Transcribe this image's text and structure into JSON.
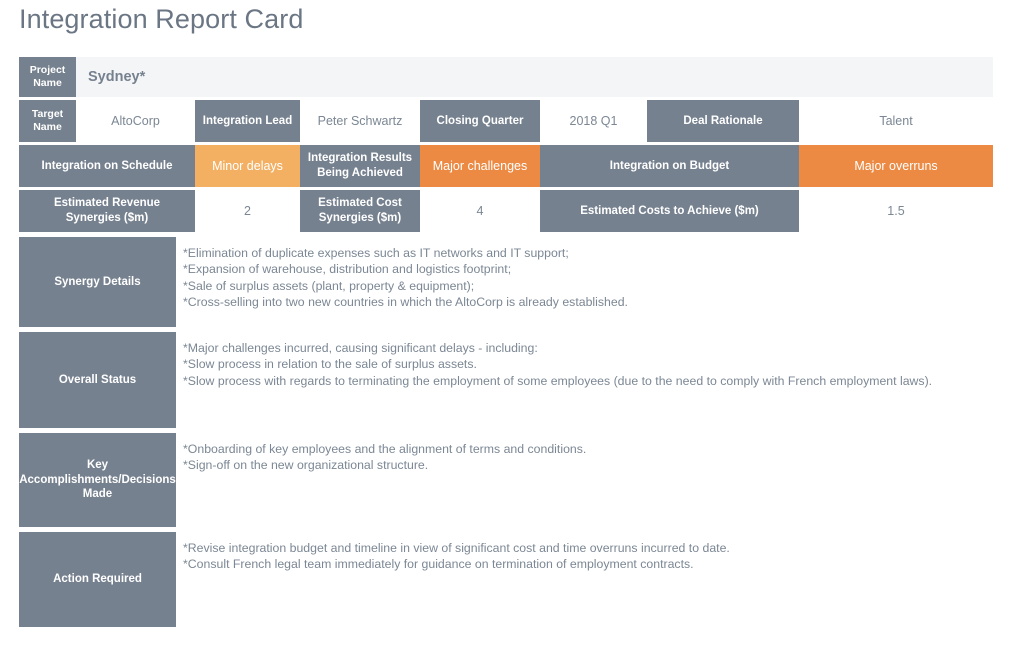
{
  "page": {
    "title": "Integration Report Card"
  },
  "colors": {
    "slate": "#76818f",
    "amber": "#f3b063",
    "orange": "#ec8a43",
    "banner_bg": "#f4f5f6",
    "value_text": "#7b8794"
  },
  "project_row": {
    "label": "Project\nName",
    "value": "Sydney*"
  },
  "target_row": {
    "cells": [
      {
        "label": "Target\nName",
        "type": "label"
      },
      {
        "label": "AltoCorp",
        "type": "value"
      },
      {
        "label": "Integration Lead",
        "type": "label"
      },
      {
        "label": "Peter Schwartz",
        "type": "value"
      },
      {
        "label": "Closing Quarter",
        "type": "label"
      },
      {
        "label": "2018 Q1",
        "type": "value"
      },
      {
        "label": "Deal Rationale",
        "type": "label"
      },
      {
        "label": "Talent",
        "type": "value"
      }
    ]
  },
  "status_row": {
    "cells": [
      {
        "label": "Integration on Schedule",
        "type": "label"
      },
      {
        "label": "Minor delays",
        "type": "amber"
      },
      {
        "label": "Integration Results\nBeing Achieved",
        "type": "label"
      },
      {
        "label": "Major challenges",
        "type": "orange"
      },
      {
        "label": "Integration on Budget",
        "type": "label"
      },
      {
        "label": "Major overruns",
        "type": "orange"
      }
    ]
  },
  "synergies_row": {
    "cells": [
      {
        "label": "Estimated Revenue\nSynergies ($m)",
        "type": "label"
      },
      {
        "label": "2",
        "type": "value"
      },
      {
        "label": "Estimated Cost\nSynergies ($m)",
        "type": "label"
      },
      {
        "label": "4",
        "type": "value"
      },
      {
        "label": "Estimated Costs to Achieve ($m)",
        "type": "label"
      },
      {
        "label": "1.5",
        "type": "value"
      }
    ]
  },
  "blocks": {
    "synergy_details": {
      "label": "Synergy Details",
      "body": "*Elimination of duplicate expenses such as IT networks and IT support;\n*Expansion of warehouse, distribution and logistics footprint;\n*Sale of surplus assets (plant, property & equipment);\n*Cross-selling into two new countries in which the AltoCorp is already established."
    },
    "overall_status": {
      "label": "Overall Status",
      "body": "*Major challenges incurred, causing significant delays - including:\n*Slow process in relation to the sale of surplus assets.\n*Slow process with regards to terminating the employment of some employees (due to the need to comply with French employment laws)."
    },
    "key_accomplishments": {
      "label": "Key\nAccomplishments/Decisions\nMade",
      "body": "*Onboarding of key employees and the alignment of terms and conditions.\n*Sign-off on the new organizational structure."
    },
    "action_required": {
      "label": "Action Required",
      "body": "*Revise integration budget and timeline in view of significant cost and time overruns incurred to date.\n*Consult French legal team immediately for guidance on termination of employment contracts."
    }
  }
}
